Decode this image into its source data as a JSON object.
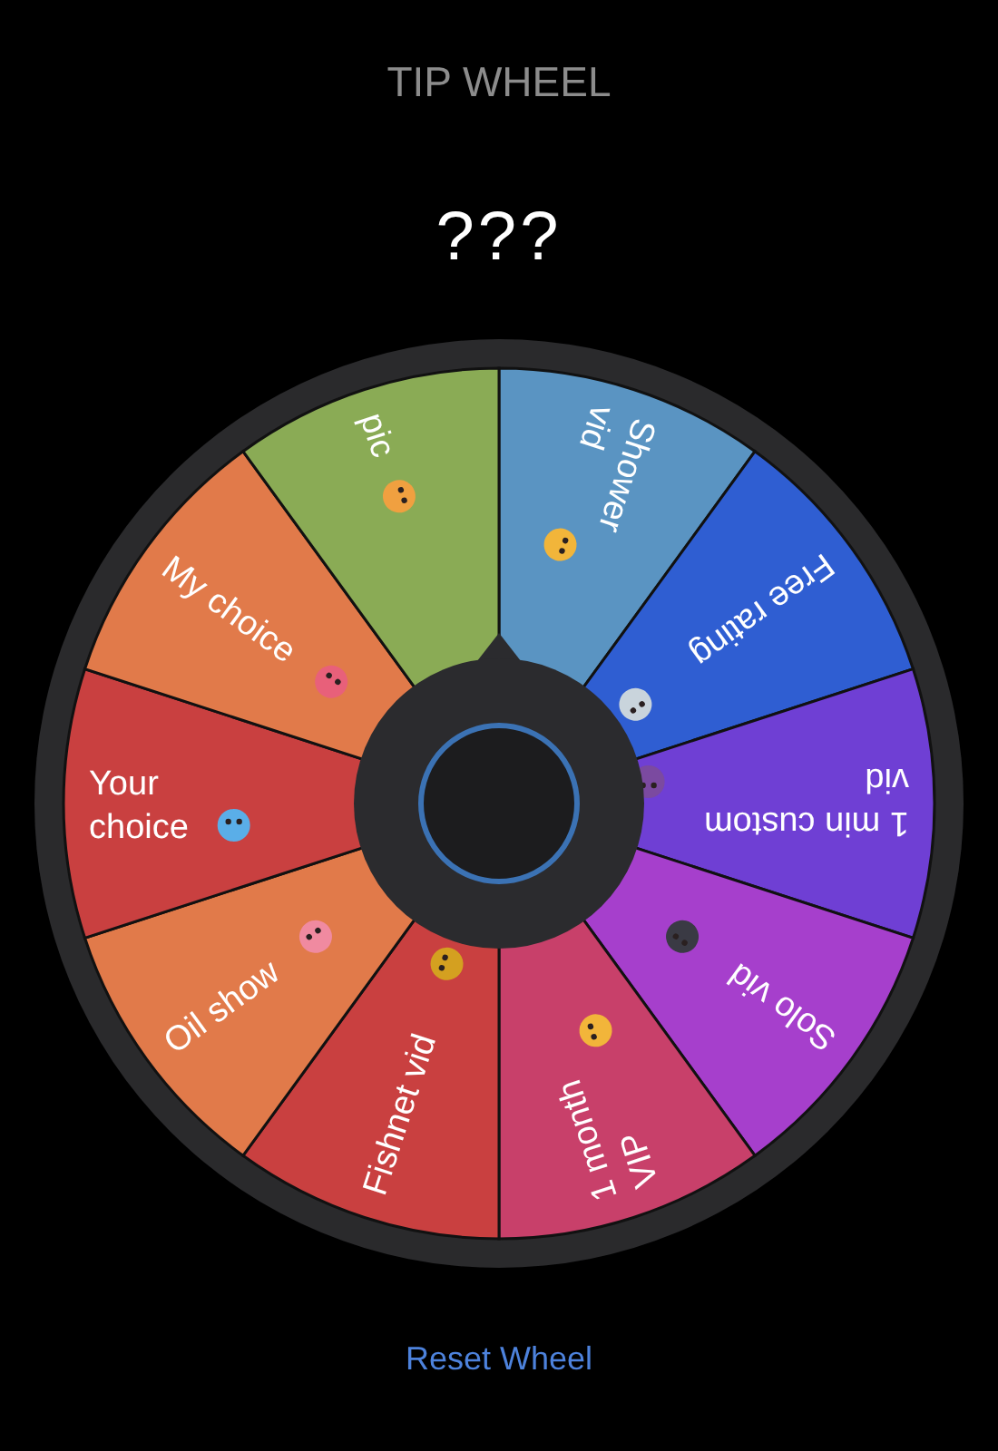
{
  "title": "TIP WHEEL",
  "result": "???",
  "segments": [
    {
      "lines": [
        "Shower",
        "vid"
      ],
      "color": "#5a94c2"
    },
    {
      "lines": [
        "Free rating"
      ],
      "color": "#2f5ed2"
    },
    {
      "lines": [
        "1 min custom",
        "vid"
      ],
      "color": "#6f3fd4"
    },
    {
      "lines": [
        "Solo vid"
      ],
      "color": "#a63fcc"
    },
    {
      "lines": [
        "1 month",
        "VIP"
      ],
      "color": "#c8406a"
    },
    {
      "lines": [
        "Fishnet vid"
      ],
      "color": "#c94040"
    },
    {
      "lines": [
        "Oil show"
      ],
      "color": "#e17a4a"
    },
    {
      "lines": [
        "Your",
        "choice"
      ],
      "color": "#c94040"
    },
    {
      "lines": [
        "My choice"
      ],
      "color": "#e17a4a"
    },
    {
      "lines": [
        "pic"
      ],
      "color": "#8aab55"
    }
  ],
  "reset_button": "Reset Wheel"
}
